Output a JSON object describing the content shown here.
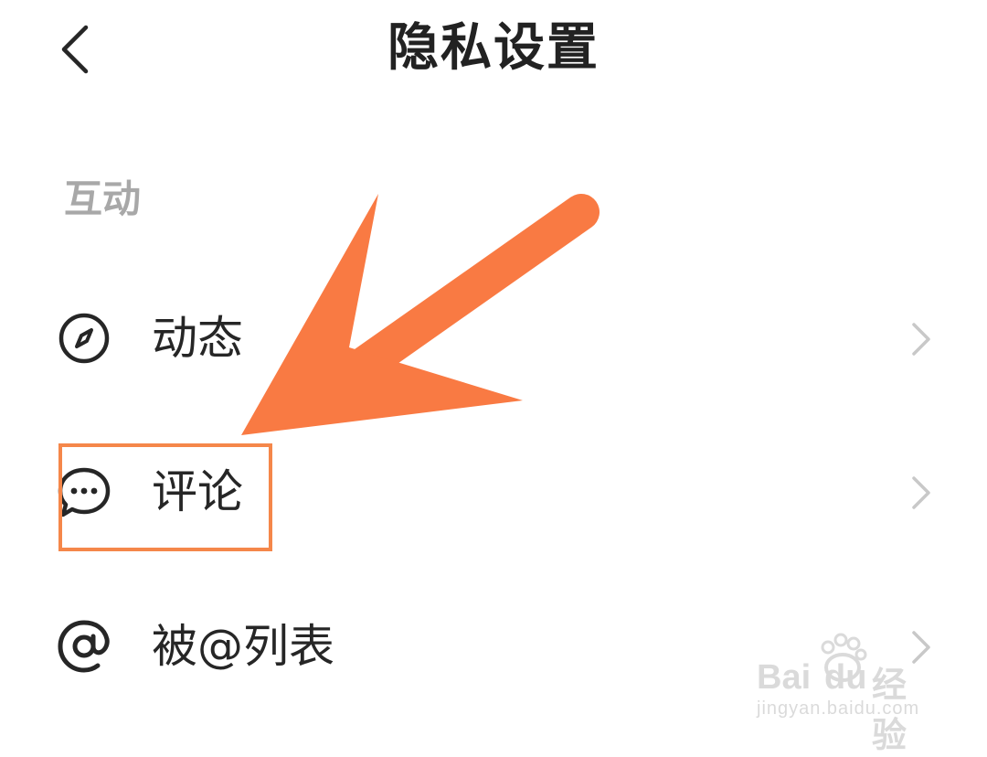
{
  "header": {
    "title": "隐私设置",
    "back_icon": "chevron-left-icon"
  },
  "section": {
    "title": "互动"
  },
  "items": [
    {
      "label": "动态",
      "icon": "compass-icon"
    },
    {
      "label": "评论",
      "icon": "comment-icon"
    },
    {
      "label": "被@列表",
      "icon": "at-sign-icon"
    }
  ],
  "annotation": {
    "arrow_color": "#f97a43",
    "highlight_color": "#f5874a"
  },
  "watermark": {
    "brand": "Bai",
    "brand2": "du",
    "brand3": "经验",
    "url": "jingyan.baidu.com"
  },
  "colors": {
    "background": "#ffffff",
    "text": "#262626",
    "section_title": "#a8a8a8",
    "chevron": "#c8c8c8"
  }
}
